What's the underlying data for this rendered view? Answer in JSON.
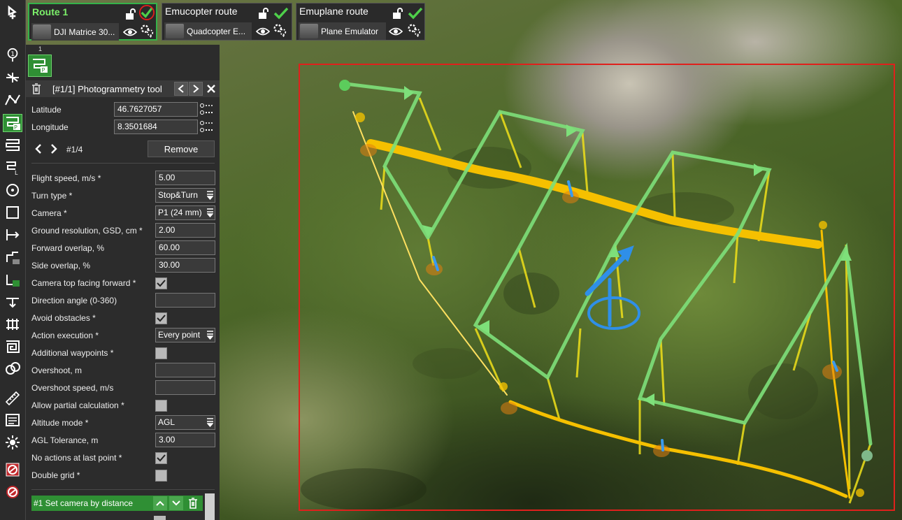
{
  "routes": [
    {
      "name": "Route 1",
      "device": "DJI Matrice 30...",
      "active": true
    },
    {
      "name": "Emucopter route",
      "device": "Quadcopter E...",
      "active": false
    },
    {
      "name": "Emuplane route",
      "device": "Plane Emulator",
      "active": false
    }
  ],
  "panel": {
    "tab_number": "1",
    "title": "[#1/1] Photogrammetry tool",
    "latitude_label": "Latitude",
    "latitude_value": "46.7627057",
    "longitude_label": "Longitude",
    "longitude_value": "8.3501684",
    "point_counter": "#1/4",
    "remove_label": "Remove",
    "fields": [
      {
        "label": "Flight speed, m/s *",
        "type": "text",
        "value": "5.00"
      },
      {
        "label": "Turn type *",
        "type": "select",
        "value": "Stop&Turn"
      },
      {
        "label": "Camera *",
        "type": "select",
        "value": "P1 (24 mm)"
      },
      {
        "label": "Ground resolution, GSD, cm *",
        "type": "text",
        "value": "2.00"
      },
      {
        "label": "Forward overlap, %",
        "type": "text",
        "value": "60.00"
      },
      {
        "label": "Side overlap, %",
        "type": "text",
        "value": "30.00"
      },
      {
        "label": "Camera top facing forward *",
        "type": "checkbox",
        "checked": true
      },
      {
        "label": "Direction angle (0-360)",
        "type": "text",
        "value": ""
      },
      {
        "label": "Avoid obstacles *",
        "type": "checkbox",
        "checked": true
      },
      {
        "label": "Action execution *",
        "type": "select",
        "value": "Every point"
      },
      {
        "label": "Additional waypoints *",
        "type": "checkbox",
        "checked": false
      },
      {
        "label": "Overshoot, m",
        "type": "text",
        "value": ""
      },
      {
        "label": "Overshoot speed, m/s",
        "type": "text",
        "value": ""
      },
      {
        "label": "Allow partial calculation *",
        "type": "checkbox",
        "checked": false
      },
      {
        "label": "Altitude mode *",
        "type": "select",
        "value": "AGL"
      },
      {
        "label": "AGL Tolerance, m",
        "type": "text",
        "value": "3.00"
      },
      {
        "label": "No actions at last point *",
        "type": "checkbox",
        "checked": true
      },
      {
        "label": "Double grid *",
        "type": "checkbox",
        "checked": false
      }
    ],
    "action_label": "#1 Set camera by distance"
  },
  "tools": [
    "waypoint-add-icon",
    "takeoff-icon",
    "polyline-icon",
    "photogrammetry-icon",
    "area-scan-icon",
    "corridor-icon",
    "circle-icon",
    "perimeter-icon",
    "vertical-scan-icon",
    "facade-icon",
    "facade-tilt-icon",
    "landing-icon",
    "grid-icon",
    "spiral-icon",
    "multi-circle-icon",
    "ruler-icon",
    "image-overlay-icon",
    "sun-icon",
    "no-fly-zone-icon",
    "restricted-zone-icon"
  ],
  "colors": {
    "accent": "#2f8f34",
    "route_path": "#f5c000",
    "grid_arrows": "#7ee07a",
    "frame": "#e0201c",
    "heading": "#2f8fe8"
  }
}
